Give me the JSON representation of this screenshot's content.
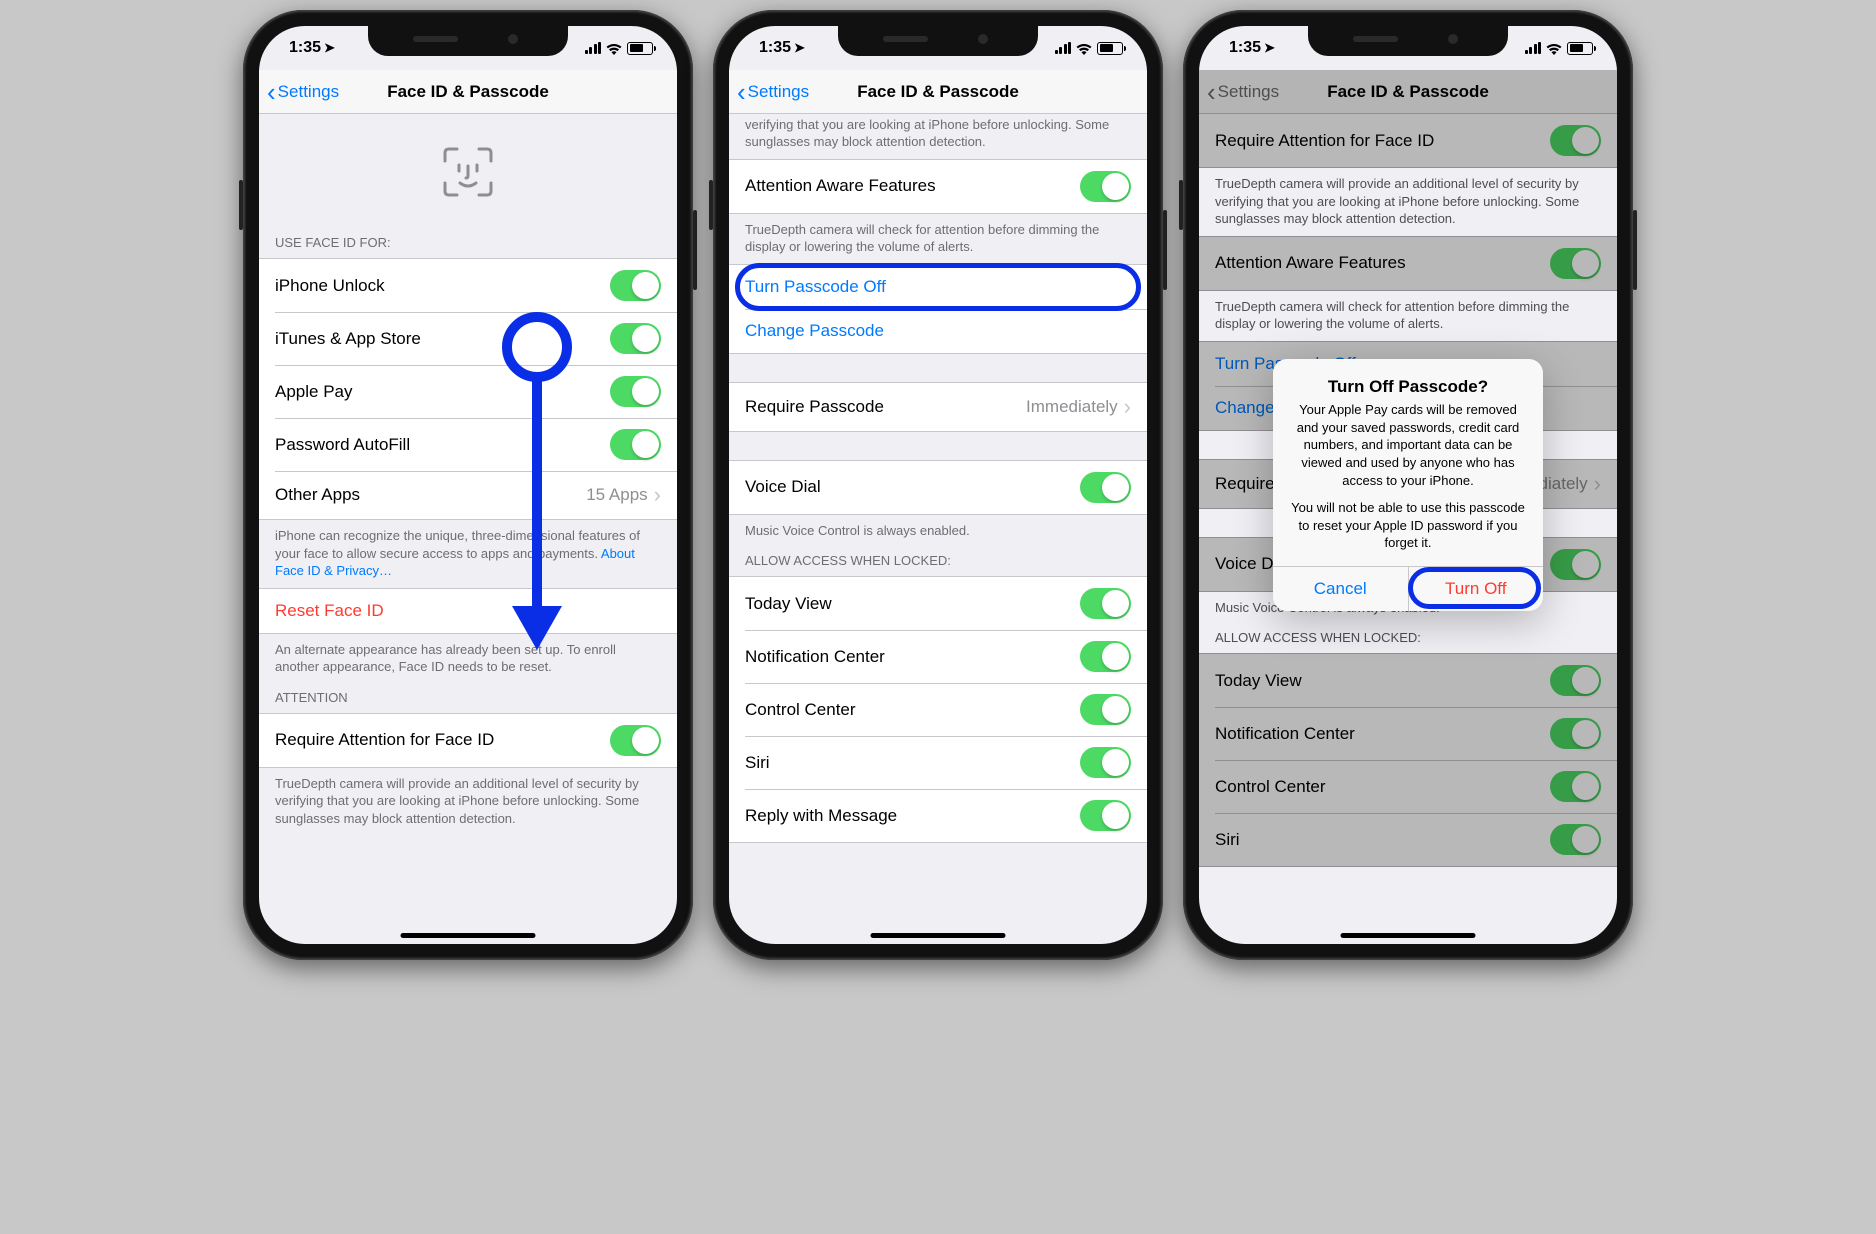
{
  "status": {
    "time": "1:35"
  },
  "nav": {
    "back": "Settings",
    "title": "Face ID & Passcode"
  },
  "s1": {
    "useHeader": "USE FACE ID FOR:",
    "items": {
      "unlock": "iPhone Unlock",
      "itunes": "iTunes & App Store",
      "applepay": "Apple Pay",
      "autofill": "Password AutoFill",
      "other": "Other Apps",
      "otherValue": "15 Apps"
    },
    "useFooter": "iPhone can recognize the unique, three-dimensional features of your face to allow secure access to apps and payments. ",
    "useFooterLink": "About Face ID & Privacy…",
    "reset": "Reset Face ID",
    "resetFooter": "An alternate appearance has already been set up. To enroll another appearance, Face ID needs to be reset.",
    "attnHeader": "ATTENTION",
    "reqAttn": "Require Attention for Face ID",
    "reqAttnFooter": "TrueDepth camera will provide an additional level of security by verifying that you are looking at iPhone before unlocking. Some sunglasses may block attention detection."
  },
  "s2": {
    "truncFooter": "TrueDepth camera will provide an additional level of security by verifying that you are looking at iPhone before unlocking. Some sunglasses may block attention detection.",
    "aaf": "Attention Aware Features",
    "aafFooter": "TrueDepth camera will check for attention before dimming the display or lowering the volume of alerts.",
    "turnOff": "Turn Passcode Off",
    "change": "Change Passcode",
    "reqPass": "Require Passcode",
    "reqPassValue": "Immediately",
    "voiceDial": "Voice Dial",
    "voiceDialFooter": "Music Voice Control is always enabled.",
    "allowHeader": "ALLOW ACCESS WHEN LOCKED:",
    "today": "Today View",
    "notif": "Notification Center",
    "cc": "Control Center",
    "siri": "Siri",
    "reply": "Reply with Message"
  },
  "s3": {
    "reqAttn": "Require Attention for Face ID",
    "truncFooter": "TrueDepth camera will provide an additional level of security by verifying that you are looking at iPhone before unlocking. Some sunglasses may block attention detection.",
    "aaf": "Attention Aware Features",
    "aafFooter": "TrueDepth camera will check for attention before dimming the display or lowering the volume of alerts.",
    "turnOff": "Turn Passcode Off",
    "change": "Change Passcode",
    "reqPass": "Require Passcode",
    "reqPassValue": "Immediately",
    "voiceDial": "Voice Dial",
    "voiceDialFooter": "Music Voice Control is always enabled.",
    "allowHeader": "ALLOW ACCESS WHEN LOCKED:",
    "today": "Today View",
    "notif": "Notification Center",
    "cc": "Control Center",
    "siri": "Siri"
  },
  "alert": {
    "title": "Turn Off Passcode?",
    "p1": "Your Apple Pay cards will be removed and your saved passwords, credit card numbers, and important data can be viewed and used by anyone who has access to your iPhone.",
    "p2": "You will not be able to use this passcode to reset your Apple ID password if you forget it.",
    "cancel": "Cancel",
    "turnoff": "Turn Off"
  }
}
